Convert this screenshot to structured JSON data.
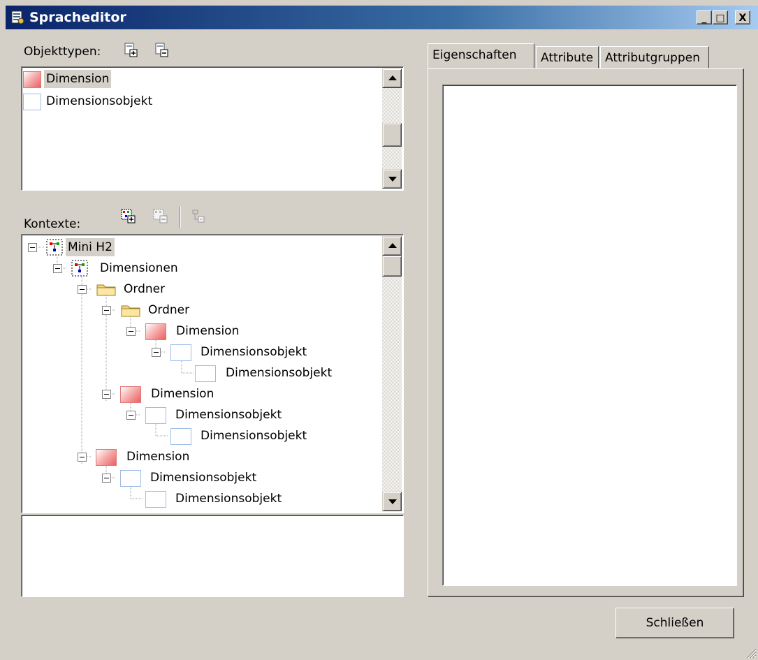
{
  "window": {
    "title": "Spracheditor",
    "controls": {
      "minimize": "_",
      "maximize": "□",
      "close": "X"
    }
  },
  "objekttypen": {
    "label": "Objekttypen:",
    "items": [
      {
        "label": "Dimension",
        "icon": "dimension-icon",
        "selected": true
      },
      {
        "label": "Dimensionsobjekt",
        "icon": "dimensionsobjekt-icon",
        "selected": false
      }
    ]
  },
  "kontexte": {
    "label": "Kontexte:",
    "tree": [
      {
        "label": "Mini H2",
        "icon": "context-icon"
      },
      {
        "label": "Dimensionen",
        "icon": "context-icon"
      },
      {
        "label": "Ordner",
        "icon": "folder-icon"
      },
      {
        "label": "Ordner",
        "icon": "folder-icon"
      },
      {
        "label": "Dimension",
        "icon": "dimension-icon"
      },
      {
        "label": "Dimensionsobjekt",
        "icon": "dimensionsobjekt-icon"
      },
      {
        "label": "Dimensionsobjekt",
        "icon": "dimensionsobjekt-icon"
      },
      {
        "label": "Dimension",
        "icon": "dimension-icon"
      },
      {
        "label": "Dimensionsobjekt",
        "icon": "dimensionsobjekt-icon"
      },
      {
        "label": "Dimensionsobjekt",
        "icon": "dimensionsobjekt-icon"
      },
      {
        "label": "Dimension",
        "icon": "dimension-icon"
      },
      {
        "label": "Dimensionsobjekt",
        "icon": "dimensionsobjekt-icon"
      },
      {
        "label": "Dimensionsobjekt",
        "icon": "dimensionsobjekt-icon"
      }
    ]
  },
  "tabs": [
    {
      "label": "Eigenschaften",
      "active": true
    },
    {
      "label": "Attribute",
      "active": false
    },
    {
      "label": "Attributgruppen",
      "active": false
    }
  ],
  "footer": {
    "close_label": "Schließen"
  },
  "colors": {
    "titlebar_start": "#0a246a",
    "titlebar_end": "#a6caf0",
    "face": "#d4d0c8"
  }
}
